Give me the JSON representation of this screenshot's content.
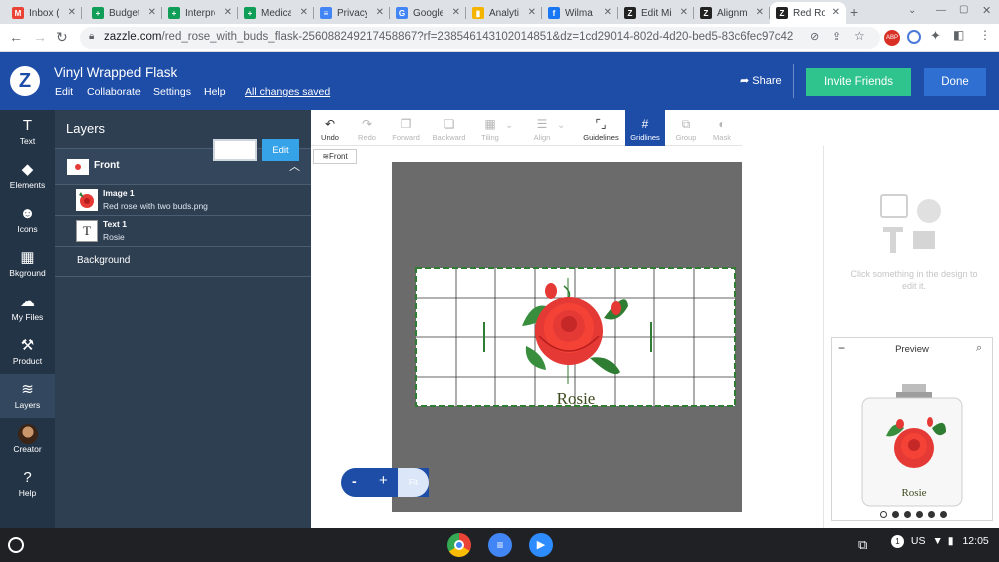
{
  "browser": {
    "tabs": [
      {
        "title": "Inbox (",
        "icon": "gmail-icon",
        "color": "#ea4335",
        "glyph": "M"
      },
      {
        "title": "Budget",
        "icon": "sheets-icon",
        "color": "#0f9d58",
        "glyph": "+"
      },
      {
        "title": "Interpret",
        "icon": "sheets-icon",
        "color": "#0f9d58",
        "glyph": "+"
      },
      {
        "title": "Medica",
        "icon": "sheets-icon",
        "color": "#0f9d58",
        "glyph": "+"
      },
      {
        "title": "Privacy",
        "icon": "docs-icon",
        "color": "#4285f4",
        "glyph": "≡"
      },
      {
        "title": "Google",
        "icon": "translate-icon",
        "color": "#4285f4",
        "glyph": "G"
      },
      {
        "title": "Analyti",
        "icon": "analytics-icon",
        "color": "#f4b400",
        "glyph": "▮"
      },
      {
        "title": "Wilma",
        "icon": "facebook-icon",
        "color": "#1877f2",
        "glyph": "f"
      },
      {
        "title": "Edit Mi",
        "icon": "zazzle-icon",
        "color": "#222222",
        "glyph": "Z"
      },
      {
        "title": "Alignm",
        "icon": "zazzle-icon",
        "color": "#222222",
        "glyph": "Z"
      },
      {
        "title": "Red Ro",
        "icon": "zazzle-icon",
        "color": "#222222",
        "glyph": "Z",
        "active": true
      }
    ],
    "new_tab": "+",
    "url_host": "zazzle.com",
    "url_path": "/red_rose_with_buds_flask-256088249217458867?rf=238546143102014851&dz=1cd29014-802d-4d20-bed5-83c6fec97c42"
  },
  "header": {
    "title": "Vinyl Wrapped Flask",
    "menu": [
      "Edit",
      "Collaborate",
      "Settings",
      "Help"
    ],
    "saved_status": "All changes saved",
    "share_label": "Share",
    "invite_label": "Invite Friends",
    "done_label": "Done"
  },
  "rail": [
    {
      "label": "Text",
      "icon": "text-icon",
      "glyph": "T"
    },
    {
      "label": "Elements",
      "icon": "shapes-icon",
      "glyph": "◆"
    },
    {
      "label": "Icons",
      "icon": "smiley-icon",
      "glyph": "☻"
    },
    {
      "label": "Bkground",
      "icon": "background-icon",
      "glyph": "▦"
    },
    {
      "label": "My Files",
      "icon": "cloud-upload-icon",
      "glyph": "☁"
    },
    {
      "label": "Product",
      "icon": "product-icon",
      "glyph": "⚒"
    },
    {
      "label": "Layers",
      "icon": "layers-icon",
      "glyph": "≋",
      "selected": true
    },
    {
      "label": "Creator",
      "icon": "avatar",
      "glyph": ""
    },
    {
      "label": "Help",
      "icon": "help-icon",
      "glyph": "?"
    }
  ],
  "layers_panel": {
    "title": "Layers",
    "group": "Front",
    "items": [
      {
        "name": "Image 1",
        "detail": "Red rose with two buds.png"
      },
      {
        "name": "Text 1",
        "detail": "Rosie"
      }
    ],
    "background_label": "Background",
    "background_color": "#ffffff",
    "edit_label": "Edit"
  },
  "toolbar": [
    {
      "label": "Undo",
      "icon": "undo-icon",
      "glyph": "↶",
      "enabled": true
    },
    {
      "label": "Redo",
      "icon": "redo-icon",
      "glyph": "↷",
      "enabled": false
    },
    {
      "label": "Forward",
      "icon": "forward-icon",
      "glyph": "❐",
      "enabled": false
    },
    {
      "label": "Backward",
      "icon": "backward-icon",
      "glyph": "❏",
      "enabled": false
    },
    {
      "label": "Tiling",
      "icon": "tiling-icon",
      "glyph": "▦",
      "enabled": false
    },
    {
      "label": "Align",
      "icon": "align-icon",
      "glyph": "☰",
      "enabled": false
    },
    {
      "label": "Guidelines",
      "icon": "guidelines-icon",
      "glyph": "⌜⌟",
      "enabled": true
    },
    {
      "label": "Gridlines",
      "icon": "gridlines-icon",
      "glyph": "#",
      "enabled": true,
      "selected": true
    },
    {
      "label": "Group",
      "icon": "group-icon",
      "glyph": "⧉",
      "enabled": false
    },
    {
      "label": "Mask",
      "icon": "mask-icon",
      "glyph": "◐",
      "enabled": false
    }
  ],
  "canvas": {
    "side_label": "Front",
    "design_text": "Rosie",
    "design_image": "rose-image"
  },
  "zoom": {
    "minus": "-",
    "plus": "+",
    "fit": "Fit"
  },
  "right_panel": {
    "hint": "Click something in the design to edit it.",
    "preview_title": "Preview",
    "preview_text": "Rosie",
    "views": 6,
    "current_view": 0
  },
  "shelf": {
    "apps": [
      "chrome-icon",
      "docs-icon",
      "zoom-icon"
    ],
    "notification_count": "1",
    "locale": "US",
    "time": "12:05"
  },
  "colors": {
    "brand_blue": "#1e4da8",
    "invite_green": "#2fc38d",
    "panel_dark": "#2e3f52",
    "rail_dark": "#243447",
    "guide_green": "#2e7d32"
  }
}
